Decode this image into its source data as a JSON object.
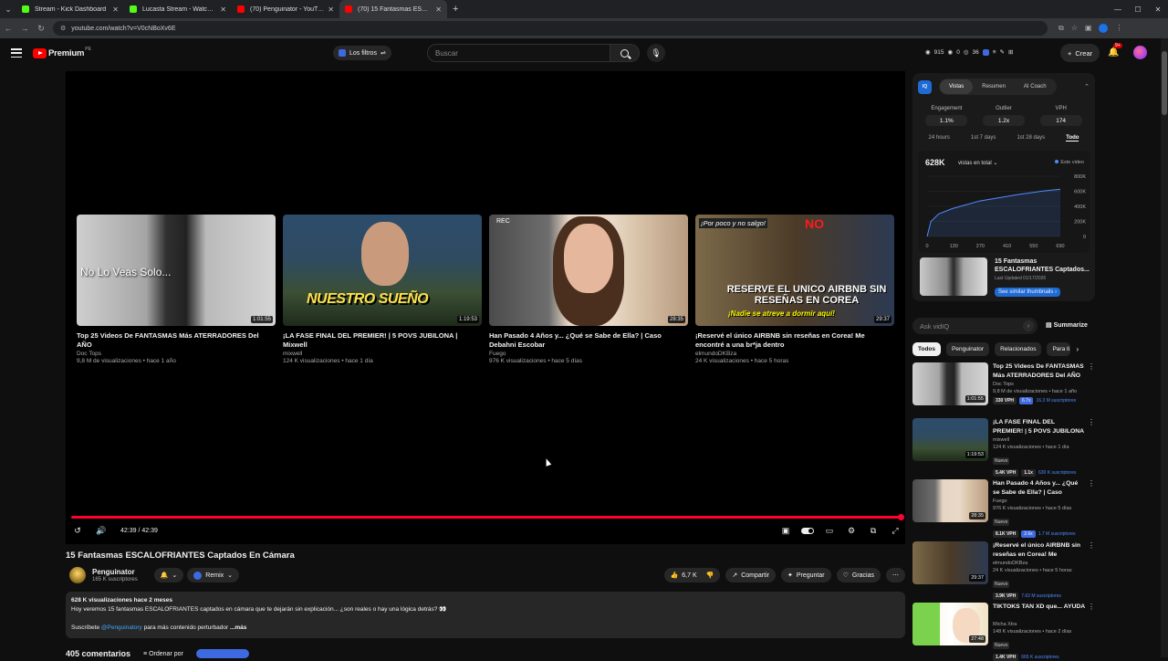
{
  "browser": {
    "tabs": [
      {
        "title": "Stream - Kick Dashboard",
        "color": "#53fc18",
        "active": false
      },
      {
        "title": "Lucasta Stream - Watch Live on",
        "color": "#53fc18",
        "active": false
      },
      {
        "title": "(70) Penguinator - YouTube",
        "color": "#ff0000",
        "active": false
      },
      {
        "title": "(70) 15 Fantasmas ESCALOFRIANTES",
        "color": "#ff0000",
        "active": true
      }
    ],
    "url": "youtube.com/watch?v=V0cNBoXv6E"
  },
  "header": {
    "logo_text": "Premium",
    "logo_country": "PE",
    "filters_label": "Los filtros",
    "search_placeholder": "Buscar",
    "stats": [
      "915",
      "0",
      "36"
    ],
    "create_label": "Crear",
    "notif_count": "9+"
  },
  "player": {
    "time": "42:39 / 42:39",
    "endcards": [
      {
        "title": "Top 25 Videos De FANTASMAS Más ATERRADORES Del AÑO",
        "channel": "Doc Tops",
        "meta": "9,8 M de visualizaciones • hace 1 año",
        "duration": "1:01:55",
        "overlay": "No Lo Veas Solo..."
      },
      {
        "title": "¡LA FASE FINAL DEL PREMIER! | 5 POVS JUBILONA | Mixwell",
        "channel": "mixwell",
        "meta": "124 K visualizaciones • hace 1 día",
        "duration": "1:19:53",
        "overlay": "NUESTRO SUEÑO"
      },
      {
        "title": "Han Pasado 4 Años y... ¿Qué se Sabe de Ella? | Caso Debahni Escobar",
        "channel": "Fuego",
        "meta": "976 K visualizaciones • hace 5 días",
        "duration": "28:35",
        "overlay": "REC"
      },
      {
        "title": "¡Reservé el único AIRBNB sin reseñas en Corea! Me encontré a una br*ja dentro",
        "channel": "elmundoDKBza",
        "meta": "24 K visualizaciones • hace 5 horas",
        "duration": "29:37",
        "overlay": "RESERVE EL UNICO AIRBNB SIN RESEÑAS EN COREA"
      }
    ]
  },
  "video": {
    "title": "15 Fantasmas ESCALOFRIANTES Captados En Cámara",
    "channel": "Penguinator",
    "subs": "165 K suscriptores",
    "remix": "Remix",
    "likes": "6,7 K",
    "share": "Compartir",
    "ask": "Preguntar",
    "thanks": "Gracias",
    "desc_meta": "628 K visualizaciones  hace 2 meses",
    "desc_text": "Hoy veremos 15 fantasmas ESCALOFRIANTES captados en cámara que te dejarán sin explicación... ¿son reales o hay una lógica detrás? 👀",
    "desc_sub_prefix": "Suscríbete",
    "desc_sub_link": "@Penguinatory",
    "desc_sub_suffix": "para más contenido perturbador",
    "desc_more": "...más",
    "comments_count": "405 comentarios",
    "sort_label": "Ordenar por"
  },
  "vidiq": {
    "tabs": [
      "Vistas",
      "Resumen",
      "AI Coach"
    ],
    "metrics": [
      {
        "label": "Engagement",
        "value": "1.1%"
      },
      {
        "label": "Outlier",
        "value": "1.2x"
      },
      {
        "label": "VPH",
        "value": "174"
      }
    ],
    "ranges": [
      "24 hours",
      "1st 7 days",
      "1st 28 days",
      "Todo"
    ],
    "total": "628K",
    "total_label": "vistas en total",
    "legend": "Este video",
    "y_ticks": [
      "800K",
      "600K",
      "400K",
      "200K",
      "0"
    ],
    "x_ticks": [
      "0",
      "130",
      "270",
      "410",
      "550",
      "690"
    ],
    "thumb_title": "15 Fantasmas ESCALOFRIANTES Captados...",
    "thumb_updated": "Last Updated 01/17/2026",
    "see_similar": "See similar thumbnails"
  },
  "sidebar": {
    "ask_placeholder": "Ask vidIQ",
    "summarize": "Summarize",
    "chips": [
      "Todos",
      "Penguinator",
      "Relacionados",
      "Para ti"
    ],
    "related": [
      {
        "title": "Top 25 Videos De FANTASMAS Más ATERRADORES Del AÑO",
        "channel": "Doc Tops",
        "meta": "9,8 M de visualizaciones • hace 1 año",
        "duration": "1:01:55",
        "vph": "330 VPH",
        "x": "6.7x",
        "subs": "16.3 M suscriptores",
        "new": ""
      },
      {
        "title": "¡LA FASE FINAL DEL PREMIER! | 5 POVS JUBILONA | Mixwell",
        "channel": "mixwell",
        "meta": "124 K visualizaciones • hace 1 día",
        "duration": "1:19:53",
        "vph": "5.4K VPH",
        "x": "1.1x",
        "subs": "630 K suscriptores",
        "new": "Nuevo"
      },
      {
        "title": "Han Pasado 4 Años y... ¿Qué se Sabe de Ella? | Caso Debahni ...",
        "channel": "Fuego",
        "meta": "976 K visualizaciones • hace 5 días",
        "duration": "28:35",
        "vph": "8.1K VPH",
        "x": "2.6x",
        "subs": "1.7 M suscriptores",
        "new": "Nuevo"
      },
      {
        "title": "¡Reservé el único AIRBNB sin reseñas en Corea! Me encontr...",
        "channel": "elmundoDKBza",
        "meta": "24 K visualizaciones • hace 5 horas",
        "duration": "29:37",
        "vph": "3.9K VPH",
        "x": "",
        "subs": "7.63 M suscriptores",
        "new": "Nuevo"
      },
      {
        "title": "TIKTOKS TAN XD que... AYUDA",
        "channel": "Micha Xtra",
        "meta": "148 K visualizaciones • hace 2 días",
        "duration": "27:48",
        "vph": "1.4K VPH",
        "x": "",
        "subs": "665 K suscriptores",
        "new": "Nuevo"
      }
    ]
  },
  "chart_data": {
    "type": "line",
    "x": [
      0,
      20,
      60,
      130,
      200,
      270,
      340,
      410,
      480,
      550,
      620,
      690
    ],
    "values": [
      0,
      200000,
      300000,
      370000,
      420000,
      470000,
      500000,
      530000,
      560000,
      585000,
      610000,
      628000
    ],
    "xlim": [
      0,
      690
    ],
    "ylim": [
      0,
      800000
    ],
    "y_ticks": [
      "800K",
      "600K",
      "400K",
      "200K",
      "0"
    ],
    "x_ticks": [
      "0",
      "130",
      "270",
      "410",
      "550",
      "690"
    ],
    "series": [
      {
        "name": "Este video"
      }
    ],
    "color": "#4f8bff"
  }
}
